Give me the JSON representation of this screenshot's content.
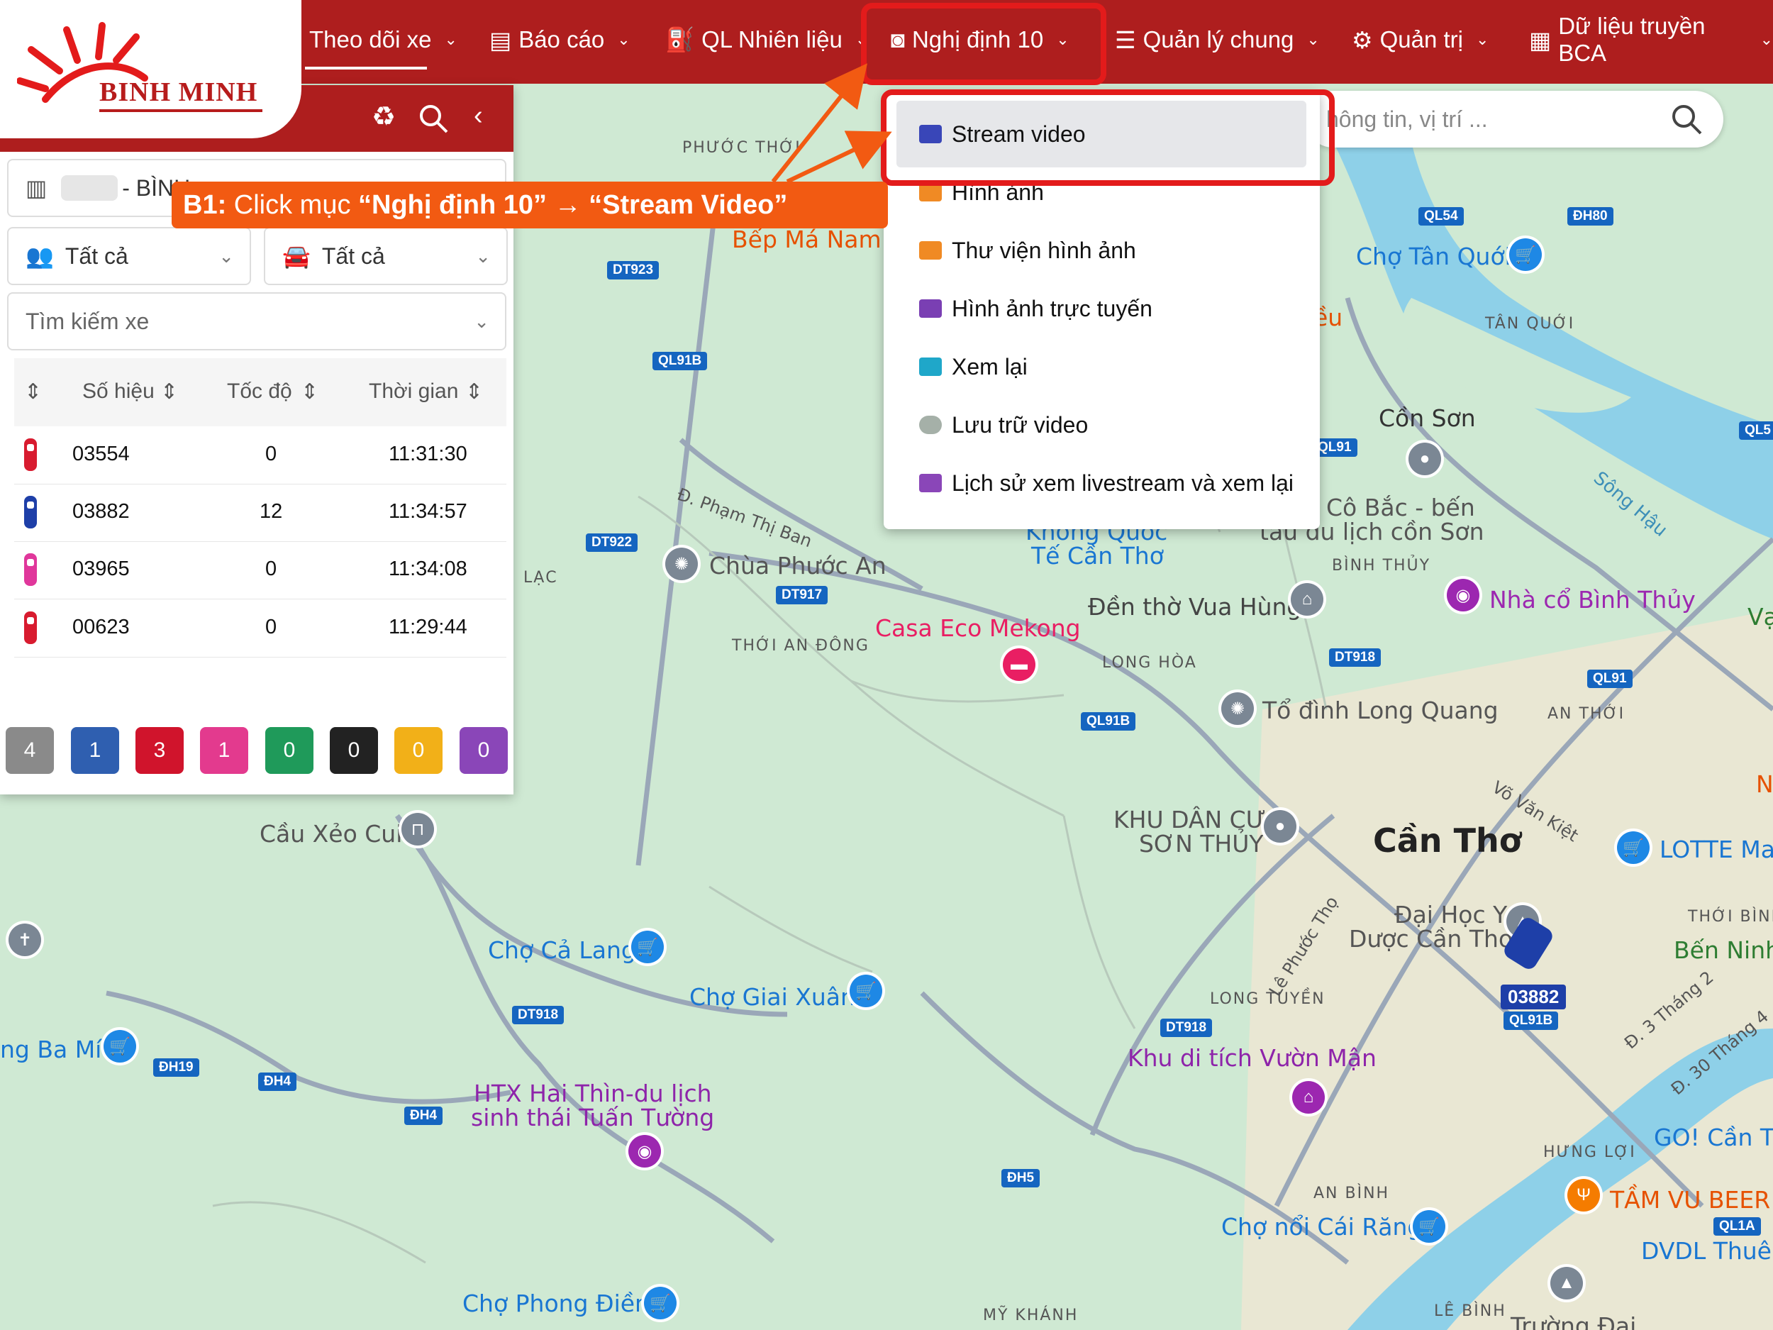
{
  "brand": {
    "logo_text": "BINH MINH",
    "primary_color": "#ae1e1e"
  },
  "nav": [
    {
      "label": "Theo dõi xe",
      "icon": "none"
    },
    {
      "label": "Báo cáo",
      "icon": "report-icon"
    },
    {
      "label": "QL Nhiên liệu",
      "icon": "fuel-icon"
    },
    {
      "label": "Nghị định 10",
      "icon": "camera-icon"
    },
    {
      "label": "Quản lý chung",
      "icon": "list-icon"
    },
    {
      "label": "Quản trị",
      "icon": "gears-icon"
    },
    {
      "label": "Dữ liệu truyền BCA",
      "icon": "document-icon"
    }
  ],
  "panel": {
    "company_label": "- BÌNH",
    "filter_driver": "Tất cả",
    "filter_vehicle": "Tất cả",
    "search_vehicle": "Tìm kiếm xe",
    "columns": [
      "Số hiệu",
      "Tốc độ",
      "Thời gian"
    ],
    "rows": [
      {
        "id": "03554",
        "speed": "0",
        "time": "11:31:30",
        "color": "#d81b2f"
      },
      {
        "id": "03882",
        "speed": "12",
        "time": "11:34:57",
        "color": "#1e3fa8"
      },
      {
        "id": "03965",
        "speed": "0",
        "time": "11:34:08",
        "color": "#e0379b"
      },
      {
        "id": "00623",
        "speed": "0",
        "time": "11:29:44",
        "color": "#d81b2f"
      }
    ],
    "badges": [
      {
        "value": "4",
        "color": "#8a8a8a"
      },
      {
        "value": "1",
        "color": "#2f5fb0"
      },
      {
        "value": "3",
        "color": "#d0142c"
      },
      {
        "value": "1",
        "color": "#e33a8e"
      },
      {
        "value": "0",
        "color": "#1f9a5a"
      },
      {
        "value": "0",
        "color": "#222222"
      },
      {
        "value": "0",
        "color": "#f2b018"
      },
      {
        "value": "0",
        "color": "#8a46b8"
      }
    ]
  },
  "map_search": {
    "placeholder": "hông tin, vị trí ..."
  },
  "dropdown": [
    {
      "label": "Stream video",
      "color": "#3946b8"
    },
    {
      "label": "Hình ảnh",
      "color": "#f08a24"
    },
    {
      "label": "Thư viện hình ảnh",
      "color": "#f08a24"
    },
    {
      "label": "Hình ảnh trực tuyến",
      "color": "#7a3fb3"
    },
    {
      "label": "Xem lại",
      "color": "#1fa7c9"
    },
    {
      "label": "Lưu trữ video",
      "color": "#a5b0a8"
    },
    {
      "label": "Lịch sử xem livestream và xem lại",
      "color": "#8a46b8"
    }
  ],
  "callout": {
    "prefix": "B1:",
    "text": " Click mục ",
    "target1": "“Nghị định 10”",
    "arrow": " → ",
    "target2": "“Stream Video”"
  },
  "map": {
    "places": [
      {
        "text": "Cần Thơ"
      },
      {
        "text": "Chợ Tân Quới"
      },
      {
        "text": "TÂN QUỚI"
      },
      {
        "text": "Cồn Sơn"
      },
      {
        "text": "Cô Bắc - bến"
      },
      {
        "text": "tàu du lịch cồn Sơn"
      },
      {
        "text": "BÌNH THỦY"
      },
      {
        "text": "Nhà cổ Bình Thủy"
      },
      {
        "text": "Đền thờ Vua Hùng"
      },
      {
        "text": "LONG HÒA"
      },
      {
        "text": "Tổ đình Long Quang"
      },
      {
        "text": "AN THỚI"
      },
      {
        "text": "KHU DÂN CƯ"
      },
      {
        "text": "SƠN THỦY"
      },
      {
        "text": "Đại Học Y"
      },
      {
        "text": "Dược Cần Thơ"
      },
      {
        "text": "LOTTE Mar"
      },
      {
        "text": "THỚI BÌNH"
      },
      {
        "text": "Bến Ninh"
      },
      {
        "text": "LONG TUYỀN"
      },
      {
        "text": "Khu di tích Vườn Mận"
      },
      {
        "text": "GO! Cần Th"
      },
      {
        "text": "TẦM VU BEER"
      },
      {
        "text": "HƯNG LỢI"
      },
      {
        "text": "AN BÌNH"
      },
      {
        "text": "Chợ nổi Cái Răng"
      },
      {
        "text": "DVDL Thuê"
      },
      {
        "text": "LÊ BÌNH"
      },
      {
        "text": "Trường Đại"
      },
      {
        "text": "MỸ KHÁNH"
      },
      {
        "text": "Chợ Phong Điền"
      },
      {
        "text": "HTX Hai Thìn-du lịch"
      },
      {
        "text": "sinh thái Tuấn Tường"
      },
      {
        "text": "Chợ Giai Xuân"
      },
      {
        "text": "Chợ Cả Lang"
      },
      {
        "text": "Cầu Xẻo Cui"
      },
      {
        "text": "ng Ba Mít"
      },
      {
        "text": "Chùa Phước An"
      },
      {
        "text": "THỚI AN ĐÔNG"
      },
      {
        "text": "Casa Eco Mekong"
      },
      {
        "text": "Không Quốc"
      },
      {
        "text": "Tế Cần Thơ"
      },
      {
        "text": "PHƯỚC THỚI"
      },
      {
        "text": "Bếp Má Nam"
      },
      {
        "text": "Đ. Phạm Thị Ban"
      },
      {
        "text": "LẠC"
      },
      {
        "text": "Võ Văn Kiệt"
      },
      {
        "text": "Lê Phước Thọ"
      },
      {
        "text": "Đ. 3 Tháng 2"
      },
      {
        "text": "Đ. 30 Tháng 4"
      },
      {
        "text": "Sông Hậu"
      },
      {
        "text": "Vạ"
      },
      {
        "text": "N"
      },
      {
        "text": "ều"
      }
    ],
    "shields": [
      "QL54",
      "ĐH80",
      "DT923",
      "QL91B",
      "DT922",
      "DT917",
      "QL91B",
      "DT918",
      "QL91",
      "QL91",
      "DT918",
      "QL91B",
      "DT918",
      "ĐH19",
      "ĐH4",
      "ĐH4",
      "ĐH5",
      "QL1A",
      "QL5"
    ],
    "vehicle_label": "03882"
  }
}
